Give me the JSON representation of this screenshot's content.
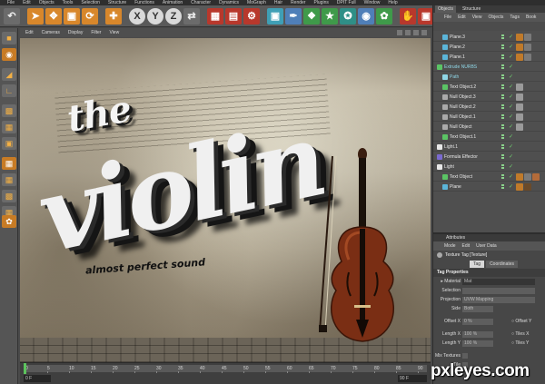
{
  "app": {
    "menu": [
      "File",
      "Edit",
      "Objects",
      "Tools",
      "Selection",
      "Structure",
      "Functions",
      "Animation",
      "Character",
      "Dynamics",
      "MoGraph",
      "Hair",
      "Render",
      "Plugins",
      "DPIT Full",
      "Window",
      "Help"
    ]
  },
  "toolbar": {
    "icons": [
      "undo-icon",
      "pointer-icon",
      "move-icon",
      "scale-icon",
      "rotate-icon",
      "world-icon",
      "x-axis-icon",
      "y-axis-icon",
      "z-axis-icon",
      "coordinate-icon",
      "render-view-icon",
      "render-picture-icon",
      "render-settings-icon",
      "cube-icon",
      "pen-icon",
      "subdivision-icon",
      "array-icon",
      "deformer-icon",
      "scene-icon",
      "light-icon",
      "grab-icon",
      "floor-icon"
    ]
  },
  "viewport": {
    "menu": [
      "Edit",
      "Cameras",
      "Display",
      "Filter",
      "View"
    ],
    "title_small": "the",
    "title_big": "violin",
    "tagline": "almost perfect sound"
  },
  "timeline": {
    "ticks": [
      "0",
      "5",
      "10",
      "15",
      "20",
      "25",
      "30",
      "35",
      "40",
      "45",
      "50",
      "55",
      "60",
      "65",
      "70",
      "75",
      "80",
      "85",
      "90"
    ],
    "frame_start": "0 F",
    "frame_end": "90 F"
  },
  "objects_panel": {
    "tabs": [
      "Objects",
      "Structure"
    ],
    "menu": [
      "File",
      "Edit",
      "View",
      "Objects",
      "Tags",
      "Book"
    ],
    "items": [
      {
        "name": "Plane.3",
        "icon_color": "#5bb5d9",
        "tags": [
          "#c07a2a",
          "#7a7a7a"
        ],
        "dim": false,
        "indent": 1
      },
      {
        "name": "Plane.2",
        "icon_color": "#5bb5d9",
        "tags": [
          "#c07a2a",
          "#7a7a7a"
        ],
        "dim": false,
        "indent": 1
      },
      {
        "name": "Plane.1",
        "icon_color": "#5bb5d9",
        "tags": [
          "#c07a2a",
          "#7a7a7a"
        ],
        "dim": false,
        "indent": 1
      },
      {
        "name": "Extrude NURBS",
        "icon_color": "#5bc465",
        "tags": [],
        "dim": true,
        "indent": 0
      },
      {
        "name": "Path",
        "icon_color": "#8fd6e6",
        "tags": [],
        "dim": true,
        "indent": 1
      },
      {
        "name": "Text Object.2",
        "icon_color": "#5bc465",
        "tags": [
          "#9a9a9a"
        ],
        "dim": false,
        "indent": 1
      },
      {
        "name": "Null Object.3",
        "icon_color": "#aaaaaa",
        "tags": [
          "#9a9a9a"
        ],
        "dim": false,
        "indent": 1
      },
      {
        "name": "Null Object.2",
        "icon_color": "#aaaaaa",
        "tags": [
          "#9a9a9a"
        ],
        "dim": false,
        "indent": 1
      },
      {
        "name": "Null Object.1",
        "icon_color": "#aaaaaa",
        "tags": [
          "#9a9a9a"
        ],
        "dim": false,
        "indent": 1
      },
      {
        "name": "Null Object",
        "icon_color": "#aaaaaa",
        "tags": [
          "#9a9a9a"
        ],
        "dim": false,
        "indent": 1
      },
      {
        "name": "Text Object.1",
        "icon_color": "#5bc465",
        "tags": [],
        "dim": false,
        "indent": 1
      },
      {
        "name": "Light.1",
        "icon_color": "#e8e8e8",
        "tags": [],
        "dim": false,
        "indent": 0
      },
      {
        "name": "Formula Effector",
        "icon_color": "#7a6ad0",
        "tags": [],
        "dim": false,
        "indent": 0
      },
      {
        "name": "Light",
        "icon_color": "#e8e8e8",
        "tags": [],
        "dim": false,
        "indent": 0
      },
      {
        "name": "Text Object",
        "icon_color": "#5bc465",
        "tags": [
          "#c07a2a",
          "#7a7a7a",
          "#b36b3a"
        ],
        "dim": false,
        "indent": 1
      },
      {
        "name": "Plane",
        "icon_color": "#5bb5d9",
        "tags": [
          "#c07a2a",
          "#6a4a2a"
        ],
        "dim": false,
        "indent": 1
      }
    ]
  },
  "attributes_panel": {
    "title": "Attributes",
    "menu": [
      "Mode",
      "Edit",
      "User Data"
    ],
    "object_label": "Texture Tag [Texture]",
    "tabs": [
      "Tag",
      "Coordinates"
    ],
    "section": "Tag Properties",
    "rows": [
      {
        "label": "▸ Material",
        "value": "Mat"
      },
      {
        "label": "Selection",
        "value": ""
      },
      {
        "label": "Projection",
        "value": "UVW Mapping"
      },
      {
        "label": "Side",
        "value": "Both"
      }
    ],
    "offset_x": {
      "label": "Offset X",
      "value": "0 %",
      "right": "○ Offset Y"
    },
    "length_x": {
      "label": "Length X",
      "value": "100 %",
      "right": "○ Tiles X"
    },
    "length_y": {
      "label": "Length Y",
      "value": "100 %",
      "right": "○ Tiles Y"
    },
    "mix": {
      "label": "Mix Textures"
    },
    "tile": {
      "label": "Tile"
    }
  },
  "watermark": "pxleyes.com"
}
